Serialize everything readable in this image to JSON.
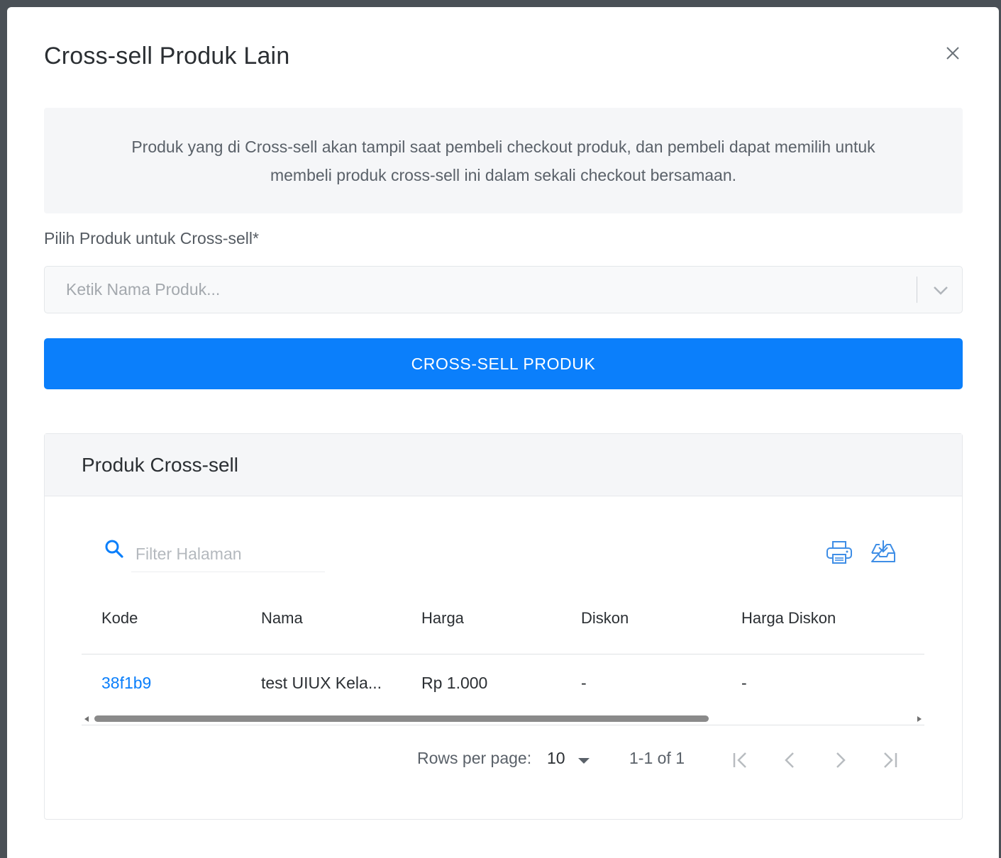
{
  "modal": {
    "title": "Cross-sell Produk Lain",
    "info_text": "Produk yang di Cross-sell akan tampil saat pembeli checkout produk, dan pembeli dapat memilih untuk membeli produk cross-sell ini dalam sekali checkout bersamaan.",
    "field_label": "Pilih Produk untuk Cross-sell*",
    "select_placeholder": "Ketik Nama Produk...",
    "submit_label": "CROSS-SELL PRODUK"
  },
  "table_card": {
    "title": "Produk Cross-sell",
    "filter_placeholder": "Filter Halaman",
    "columns": [
      "Kode",
      "Nama",
      "Harga",
      "Diskon",
      "Harga Diskon"
    ],
    "rows": [
      {
        "kode": "38f1b9",
        "nama": "test UIUX Kela...",
        "harga": "Rp 1.000",
        "diskon": "-",
        "harga_diskon": "-"
      }
    ],
    "pagination": {
      "rows_per_page_label": "Rows per page:",
      "rows_per_page_value": "10",
      "range_text": "1-1 of 1"
    }
  },
  "icons": {
    "close": "close-icon",
    "dropdown": "chevron-down-icon",
    "search": "search-icon",
    "print": "printer-icon",
    "export": "download-tray-icon",
    "first": "first-page-icon",
    "prev": "chevron-left-icon",
    "next": "chevron-right-icon",
    "last": "last-page-icon"
  },
  "colors": {
    "primary": "#0b7ffb",
    "backdrop": "#4a5056",
    "panel_bg": "#f5f6f8"
  }
}
